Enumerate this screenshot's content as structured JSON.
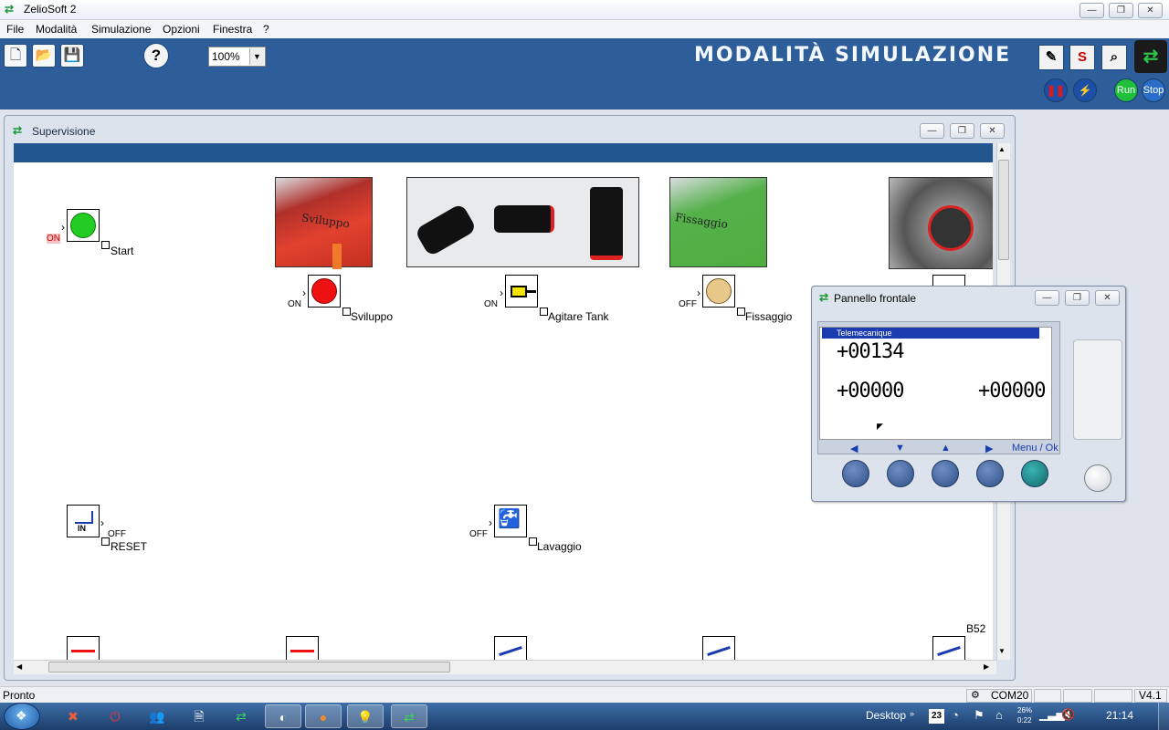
{
  "app": {
    "title": "ZelioSoft 2"
  },
  "menu": {
    "items": [
      "File",
      "Modalità",
      "Simulazione",
      "Opzioni",
      "Finestra",
      "?"
    ]
  },
  "toolbar": {
    "zoom": "100%",
    "mode_title": "MODALITÀ SIMULAZIONE",
    "s_label": "S",
    "run_label": "Run",
    "stop_label": "Stop"
  },
  "supervision": {
    "title": "Supervisione",
    "jug_sviluppo_text": "Sviluppo",
    "jug_fissaggio_text": "Fissaggio",
    "start": {
      "state": "ON",
      "label": "Start"
    },
    "sviluppo": {
      "state": "ON",
      "label": "Sviluppo"
    },
    "agitare": {
      "state": "ON",
      "label": "Agitare Tank"
    },
    "fissaggio": {
      "state": "OFF",
      "label": "Fissaggio"
    },
    "reset": {
      "state": "OFF",
      "label": "RESET",
      "icon_text": "IN"
    },
    "lavaggio": {
      "state": "OFF",
      "label": "Lavaggio"
    },
    "b52_label": "B52"
  },
  "front_panel": {
    "title": "Pannello frontale",
    "brand": "Telemecanique",
    "value1": "+00134",
    "value2": "+00000",
    "value3": "+00000",
    "menu_ok": "Menu / Ok",
    "arrows": [
      "◀",
      "▼",
      "▲",
      "▶"
    ]
  },
  "status": {
    "text": "Pronto",
    "com": "COM20",
    "version": "V4.1"
  },
  "taskbar": {
    "desktop": "Desktop",
    "date_badge": "23",
    "battery_text": "26%",
    "battery_time": "0:22",
    "clock": "21:14"
  },
  "colors": {
    "band": "#2d5e9a",
    "lamp_green": "#22cc22",
    "lamp_red": "#ee1111",
    "lamp_off": "#e8c88a",
    "lcd_header": "#1a3cae"
  }
}
